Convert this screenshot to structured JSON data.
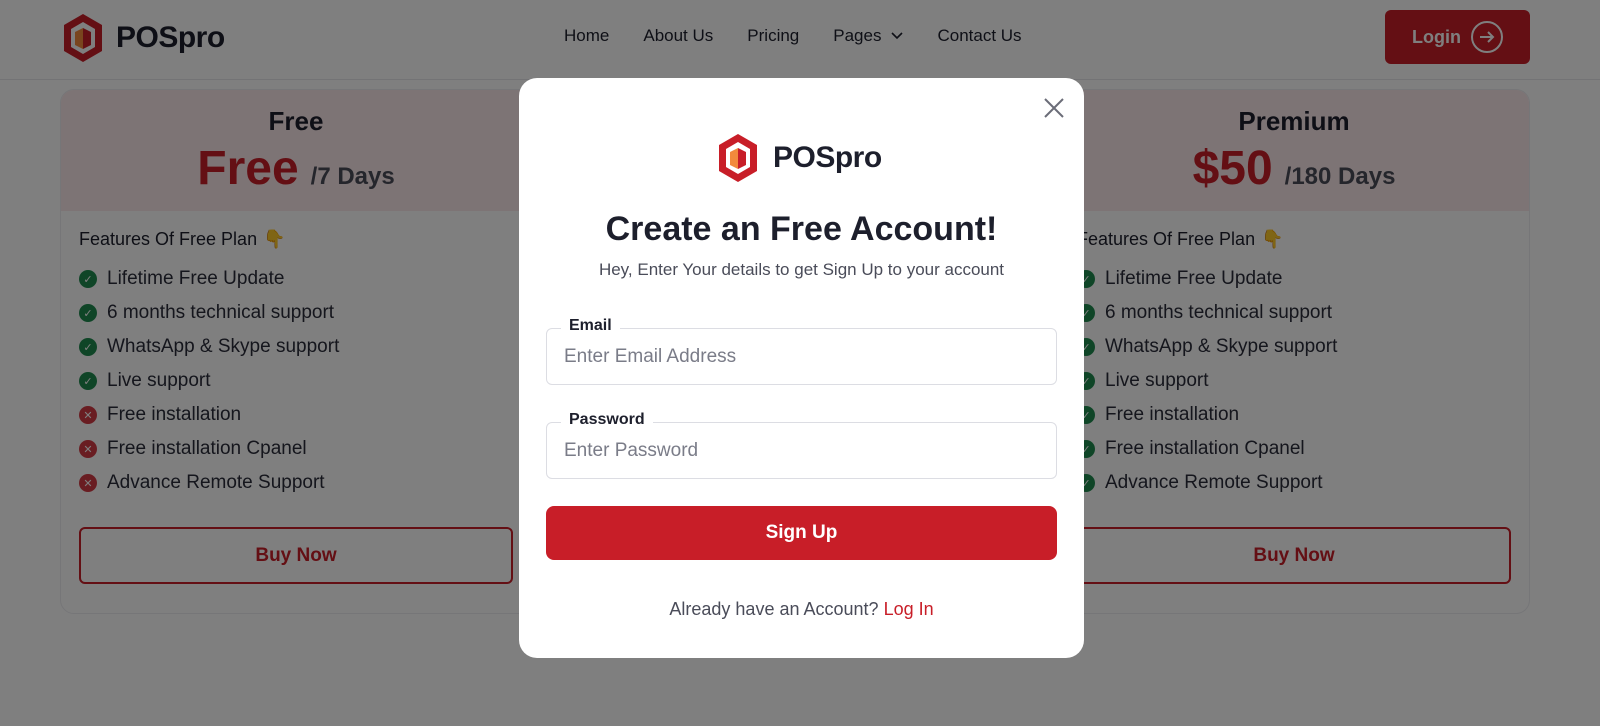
{
  "brand": {
    "name": "POSpro",
    "accent": "#c81e28"
  },
  "nav": {
    "items": [
      {
        "label": "Home"
      },
      {
        "label": "About Us"
      },
      {
        "label": "Pricing"
      },
      {
        "label": "Pages"
      },
      {
        "label": "Contact Us"
      }
    ],
    "login_label": "Login"
  },
  "plans": {
    "left": {
      "name": "Free",
      "price": "Free",
      "period": "/7 Days",
      "features_title": "Features Of Free Plan",
      "features": [
        {
          "label": "Lifetime Free Update",
          "included": true
        },
        {
          "label": "6 months technical support",
          "included": true
        },
        {
          "label": "WhatsApp & Skype support",
          "included": true
        },
        {
          "label": "Live support",
          "included": true
        },
        {
          "label": "Free installation",
          "included": false
        },
        {
          "label": "Free installation Cpanel",
          "included": false
        },
        {
          "label": "Advance Remote Support",
          "included": false
        }
      ],
      "button": "Buy Now"
    },
    "right": {
      "name": "Premium",
      "price": "$50",
      "period": "/180 Days",
      "features_title": "Features Of Free Plan",
      "features": [
        {
          "label": "Lifetime Free Update",
          "included": true
        },
        {
          "label": "6 months technical support",
          "included": true
        },
        {
          "label": "WhatsApp & Skype support",
          "included": true
        },
        {
          "label": "Live support",
          "included": true
        },
        {
          "label": "Free installation",
          "included": true
        },
        {
          "label": "Free installation Cpanel",
          "included": true
        },
        {
          "label": "Advance Remote Support",
          "included": true
        }
      ],
      "button": "Buy Now"
    }
  },
  "modal": {
    "brand": "POSpro",
    "title": "Create an Free Account!",
    "subtitle": "Hey, Enter Your details to get Sign Up to your account",
    "email": {
      "label": "Email",
      "placeholder": "Enter Email Address",
      "value": ""
    },
    "password": {
      "label": "Password",
      "placeholder": "Enter Password",
      "value": ""
    },
    "submit": "Sign Up",
    "footer_text": "Already have an Account?",
    "footer_link": "Log In"
  }
}
